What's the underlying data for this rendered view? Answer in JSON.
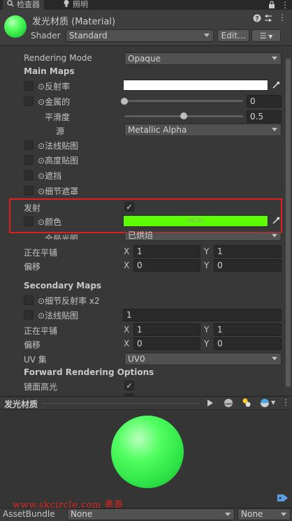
{
  "tabs": [
    {
      "label": "检查器",
      "icon": "inspector-icon",
      "active": true
    },
    {
      "label": "照明",
      "icon": "lightbulb-icon",
      "active": false
    }
  ],
  "header": {
    "title": "发光材质 (Material)",
    "shader_label": "Shader",
    "shader_value": "Standard",
    "edit_button": "Edit..."
  },
  "props": {
    "rendering_mode_label": "Rendering Mode",
    "rendering_mode_value": "Opaque",
    "main_maps": "Main Maps",
    "albedo": "反射率",
    "metallic": "金属的",
    "metallic_value": "0",
    "smoothness": "平滑度",
    "smoothness_value": "0.5",
    "source": "源",
    "source_value": "Metallic Alpha",
    "normal_map": "法线贴图",
    "height_map": "高度贴图",
    "occlusion": "遮挡",
    "detail_mask": "细节遮罩",
    "emission": "发射",
    "color": "颜色",
    "hdr": "HDR",
    "global_illum": "全局光照",
    "global_illum_value": "已烘焙",
    "tiling": "正在平铺",
    "tiling_x": "1",
    "tiling_y": "1",
    "offset": "偏移",
    "offset_x": "0",
    "offset_y": "0",
    "x": "X",
    "y": "Y",
    "secondary_maps": "Secondary Maps",
    "detail_albedo": "细节反射率 x2",
    "sec_normal_map": "法线贴图",
    "sec_normal_value": "1",
    "sec_tiling": "正在平铺",
    "sec_tiling_x": "1",
    "sec_tiling_y": "1",
    "sec_offset": "偏移",
    "sec_offset_x": "0",
    "sec_offset_y": "0",
    "uv_set": "UV 集",
    "uv_set_value": "UV0",
    "forward_options": "Forward Rendering Options",
    "specular_highlights": "镜面高光"
  },
  "values": {
    "smoothness_fraction": 0.5,
    "metallic_fraction": 0.0
  },
  "colors": {
    "emission_color": "#5dfc05",
    "albedo_color": "#ffffff",
    "highlight_box": "#e02020",
    "material_green": "#41f655"
  },
  "preview": {
    "title": "发光材质"
  },
  "watermark": "www.skcircle.com 勇哥",
  "asset_bundle": {
    "label": "AssetBundle",
    "value": "None",
    "variant": "None"
  }
}
